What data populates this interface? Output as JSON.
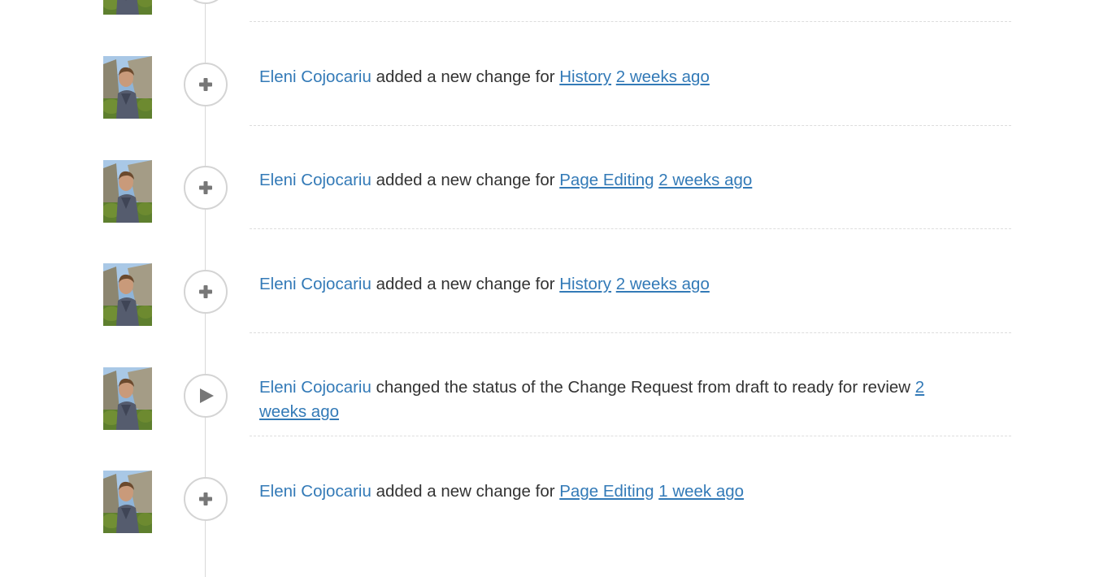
{
  "timeline": {
    "entries": [
      {
        "user": "Eleni Cojocariu",
        "action": " added a new change for ",
        "target": "History",
        "time": "2 weeks ago",
        "icon": "plus-icon"
      },
      {
        "user": "Eleni Cojocariu",
        "action": " added a new change for ",
        "target": "Page Editing",
        "time": "2 weeks ago",
        "icon": "plus-icon"
      },
      {
        "user": "Eleni Cojocariu",
        "action": " added a new change for ",
        "target": "History",
        "time": "2 weeks ago",
        "icon": "plus-icon"
      },
      {
        "user": "Eleni Cojocariu",
        "action": " changed the status of the Change Request from draft to ready for review ",
        "time": "2 weeks ago",
        "icon": "play-icon"
      },
      {
        "user": "Eleni Cojocariu",
        "action": " added a new change for ",
        "target": "Page Editing",
        "time": "1 week ago",
        "icon": "plus-icon"
      }
    ]
  },
  "colors": {
    "link": "#337ab7",
    "text": "#333333",
    "marker_border": "#d4d4d4",
    "icon": "#777777"
  }
}
